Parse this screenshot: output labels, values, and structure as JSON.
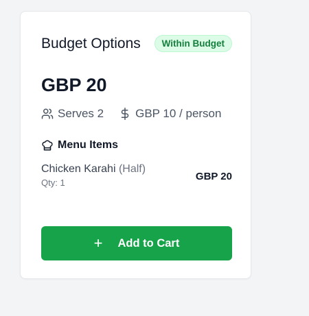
{
  "card": {
    "title": "Budget Options",
    "badge": "Within Budget",
    "price": "GBP 20",
    "serves": "Serves 2",
    "per_person": "GBP 10 / person",
    "menu_title": "Menu Items",
    "items": [
      {
        "name": "Chicken Karahi",
        "variant": "(Half)",
        "qty": "Qty: 1",
        "price": "GBP 20"
      }
    ],
    "add_to_cart_label": "Add to Cart"
  },
  "colors": {
    "accent": "#16a34a",
    "badge_bg": "#dcfce7",
    "badge_text": "#15803d"
  },
  "icons": {
    "serves": "users-icon",
    "per_person": "dollar-icon",
    "menu": "chef-hat-icon",
    "add": "plus-icon"
  }
}
